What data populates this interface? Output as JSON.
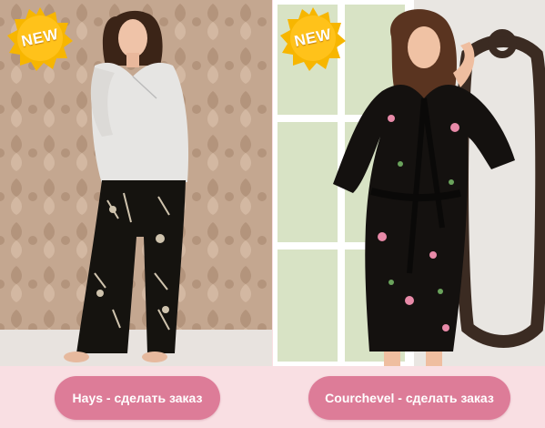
{
  "products": [
    {
      "badge_text": "NEW",
      "image_alt": "Hays pajama set",
      "button_label": "Hays - сделать заказ"
    },
    {
      "badge_text": "NEW",
      "image_alt": "Courchevel floral robe",
      "button_label": "Courchevel - сделать заказ"
    }
  ],
  "colors": {
    "page_background": "#f9dfe3",
    "button_background": "#dd7c98",
    "button_text": "#ffffff",
    "badge_fill": "#f7b600"
  },
  "icons": {
    "badge": "starburst-badge-icon"
  }
}
